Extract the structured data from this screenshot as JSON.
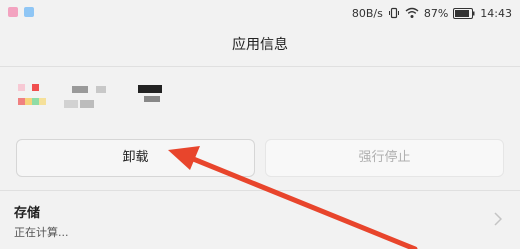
{
  "status_bar": {
    "net_speed": "80B/s",
    "battery_percent": "87%",
    "time": "14:43",
    "icons": [
      "notification-pink-icon",
      "notification-blue-icon",
      "vibrate-icon",
      "wifi-icon",
      "battery-icon"
    ],
    "colors": {
      "notif_pink": "#f3a3c0",
      "notif_blue": "#8fc6f5"
    }
  },
  "title_bar": {
    "title": "应用信息"
  },
  "app_header": {
    "icon": "pixelated-app-icon",
    "icon_colors": [
      "#f7c9d4",
      "#f04e4e",
      "#f7d27a",
      "#f08080",
      "#8fdca6",
      "#f5e09a"
    ]
  },
  "buttons": {
    "uninstall": "卸载",
    "force_stop": "强行停止"
  },
  "storage": {
    "title": "存储",
    "subtitle": "正在计算..."
  },
  "annotation": {
    "arrow_color": "#e8452c",
    "arrow_target": "uninstall-button"
  }
}
